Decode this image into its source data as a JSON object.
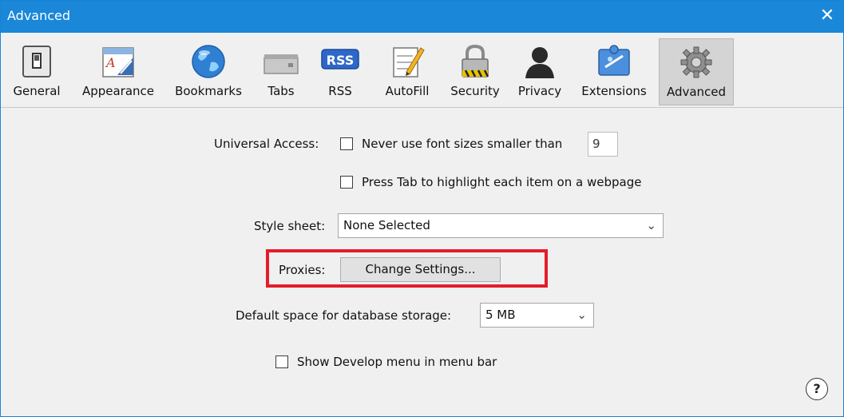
{
  "window": {
    "title": "Advanced",
    "close_glyph": "✕"
  },
  "toolbar": {
    "items": [
      {
        "label": "General",
        "icon": "general-switch-icon"
      },
      {
        "label": "Appearance",
        "icon": "appearance-font-icon"
      },
      {
        "label": "Bookmarks",
        "icon": "globe-bookmarks-icon"
      },
      {
        "label": "Tabs",
        "icon": "tabs-icon"
      },
      {
        "label": "RSS",
        "icon": "rss-badge-icon",
        "badge_text": "RSS"
      },
      {
        "label": "AutoFill",
        "icon": "autofill-pencil-icon"
      },
      {
        "label": "Security",
        "icon": "padlock-icon"
      },
      {
        "label": "Privacy",
        "icon": "person-silhouette-icon"
      },
      {
        "label": "Extensions",
        "icon": "puzzle-extensions-icon"
      },
      {
        "label": "Advanced",
        "icon": "gears-icon",
        "selected": true
      }
    ]
  },
  "settings": {
    "universal_access_label": "Universal Access:",
    "font_size_check_label": "Never use font sizes smaller than",
    "font_size_value": "9",
    "tab_highlight_label": "Press Tab to highlight each item on a webpage",
    "style_sheet_label": "Style sheet:",
    "style_sheet_value": "None Selected",
    "proxies_label": "Proxies:",
    "change_settings_label": "Change Settings...",
    "db_storage_label": "Default space for database storage:",
    "db_storage_value": "5 MB",
    "develop_menu_label": "Show Develop menu in menu bar",
    "help_glyph": "?"
  },
  "colors": {
    "titlebar": "#1a87d9",
    "highlight_box": "#e51c2a",
    "selected_tab": "#d4d4d4"
  }
}
